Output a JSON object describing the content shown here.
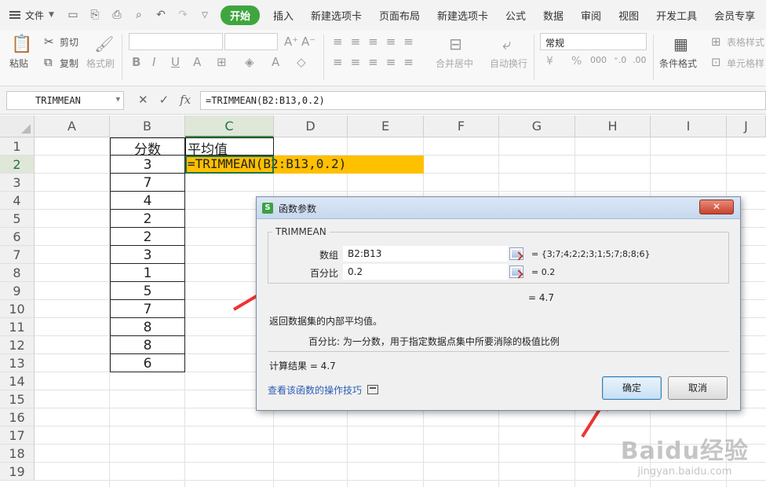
{
  "menubar": {
    "file_label": "文件",
    "tabs": [
      "开始",
      "插入",
      "新建选项卡",
      "页面布局",
      "新建选项卡",
      "公式",
      "数据",
      "审阅",
      "视图",
      "开发工具",
      "会员专享"
    ]
  },
  "ribbon": {
    "paste": "粘贴",
    "cut": "剪切",
    "copy": "复制",
    "format_painter": "格式刷",
    "merge_center": "合并居中",
    "wrap_text": "自动换行",
    "number_format": "常规",
    "conditional_format": "条件格式",
    "table_style": "表格样式",
    "cell_style": "单元格样",
    "currency": "¥",
    "percent": "%"
  },
  "formula_bar": {
    "name_box": "TRIMMEAN",
    "formula": "=TRIMMEAN(B2:B13,0.2)"
  },
  "sheet": {
    "columns": [
      "A",
      "B",
      "C",
      "D",
      "E",
      "F",
      "G",
      "H",
      "I",
      "J"
    ],
    "rows": [
      "1",
      "2",
      "3",
      "4",
      "5",
      "6",
      "7",
      "8",
      "9",
      "10",
      "11",
      "12",
      "13",
      "14",
      "15",
      "16",
      "17",
      "18",
      "19"
    ],
    "b_header": "分数",
    "c_header": "平均值",
    "scores": [
      "3",
      "7",
      "4",
      "2",
      "2",
      "3",
      "1",
      "5",
      "7",
      "8",
      "8",
      "6"
    ],
    "c2_formula": "=TRIMMEAN(B2:B13,0.2)"
  },
  "dialog": {
    "title": "函数参数",
    "close": "✕",
    "function_name": "TRIMMEAN",
    "arg1_label": "数组",
    "arg1_value": "B2:B13",
    "arg1_result": "= {3;7;4;2;2;3;1;5;7;8;8;6}",
    "arg2_label": "百分比",
    "arg2_value": "0.2",
    "arg2_result": "= 0.2",
    "formula_result": "= 4.7",
    "description": "返回数据集的内部平均值。",
    "param_desc": "百分比:   为一分数，用于指定数据点集中所要消除的极值比例",
    "calc_result": "计算结果 = 4.7",
    "help_link": "查看该函数的操作技巧",
    "ok_button": "确定",
    "cancel_button": "取消"
  },
  "watermark": {
    "line1": "Baidu经验",
    "line2": "jingyan.baidu.com"
  }
}
